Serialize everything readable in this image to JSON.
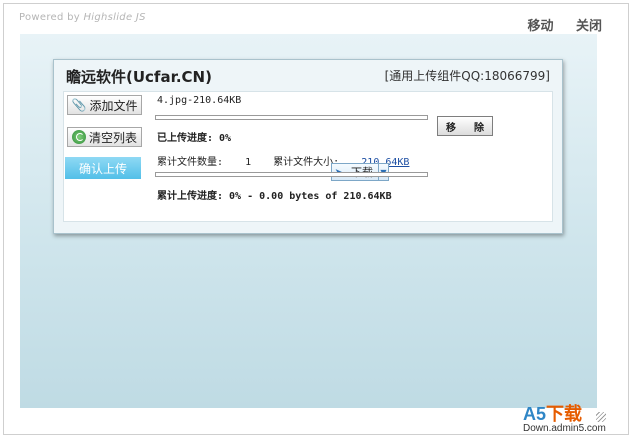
{
  "header": {
    "powered_prefix": "Powered by",
    "powered_brand": "Highslide JS",
    "move": "移动",
    "close": "关闭"
  },
  "dialog": {
    "title": "瞻远软件(Ucfar.CN)",
    "qq": "[通用上传组件QQ:18066799]"
  },
  "sidebar": {
    "add_files": "添加文件",
    "clear_list": "清空列表",
    "confirm_upload": "确认上传"
  },
  "file": {
    "name": "4.jpg-210.64KB",
    "progress_label": "已上传进度: 0%",
    "progress_fraction": 0,
    "remove": "移 除"
  },
  "stats": {
    "count_label": "累计文件数量:",
    "count": "1",
    "size_label": "累计文件大小:",
    "size": "210.64KB",
    "total_progress": "累计上传进度: 0% - 0.00 bytes of 210.64KB",
    "total_fraction": 0
  },
  "download_button": {
    "label": "下载",
    "icon": "download-icon"
  },
  "watermark": {
    "main_a": "A5",
    "main_b": "下载",
    "sub": "Down.admin5.com"
  },
  "colors": {
    "confirm_bg": "#52bfe8",
    "link": "#1d4fa3",
    "watermark_blue": "#2f86c6",
    "watermark_orange": "#e65c00"
  }
}
